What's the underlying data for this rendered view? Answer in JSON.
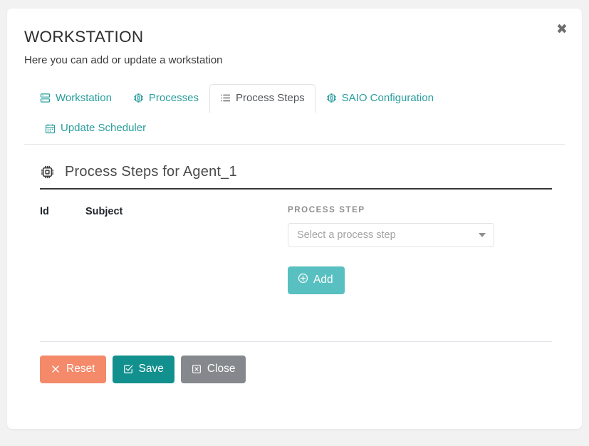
{
  "modal": {
    "title": "WORKSTATION",
    "subtitle": "Here you can add or update a workstation",
    "close_icon": "close-icon",
    "close_glyph": "✖"
  },
  "tabs": [
    {
      "label": "Workstation",
      "icon": "server-icon",
      "active": false
    },
    {
      "label": "Processes",
      "icon": "microchip-icon",
      "active": false
    },
    {
      "label": "Process Steps",
      "icon": "list-icon",
      "active": true
    },
    {
      "label": "SAIO Configuration",
      "icon": "microchip-icon",
      "active": false
    },
    {
      "label": "Update Scheduler",
      "icon": "calendar-icon",
      "active": false
    }
  ],
  "section": {
    "icon": "microchip-icon",
    "title": "Process Steps for Agent_1"
  },
  "table": {
    "columns": [
      "Id",
      "Subject"
    ],
    "rows": []
  },
  "form": {
    "field_label": "PROCESS STEP",
    "select_placeholder": "Select a process step",
    "select_value": "",
    "caret_icon": "chevron-down-icon",
    "add_label": "Add",
    "add_icon": "plus-circle-icon"
  },
  "footer": {
    "reset_label": "Reset",
    "reset_icon": "times-icon",
    "save_label": "Save",
    "save_icon": "check-square-icon",
    "close_label": "Close",
    "close_icon": "times-square-icon"
  },
  "colors": {
    "tab_link": "#2a9d9d",
    "tab_active_text": "#525559",
    "add_button": "#58c0c0",
    "reset_button": "#f48a6a",
    "save_button": "#12908e",
    "close_button": "#85898d",
    "page_background": "#f2f2f2",
    "card_background": "#ffffff"
  }
}
